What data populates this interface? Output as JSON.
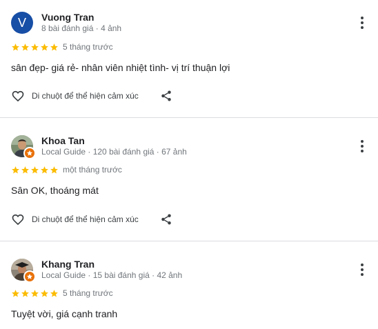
{
  "reviews": [
    {
      "avatar_letter": "V",
      "avatar_color": "#174ea6",
      "name": "Vuong Tran",
      "meta": "8 bài đánh giá · 4 ảnh",
      "rating": 5,
      "time": "5 tháng trước",
      "text": "sân đẹp- giá rẻ- nhân viên nhiệt tình- vị trí thuận lợi",
      "like_label": "Di chuột để thể hiện cảm xúc"
    },
    {
      "avatar_icon": "profile-photo-icon",
      "name": "Khoa Tan",
      "meta": "Local Guide · 120 bài đánh giá · 67 ảnh",
      "rating": 5,
      "time": "một tháng trước",
      "text": "Sân OK, thoáng mát",
      "like_label": "Di chuột để thể hiện cảm xúc"
    },
    {
      "avatar_icon": "profile-photo-icon",
      "name": "Khang Tran",
      "meta": "Local Guide · 15 bài đánh giá · 42 ảnh",
      "rating": 5,
      "time": "5 tháng trước",
      "text": "Tuyệt vời, giá cạnh tranh"
    }
  ],
  "colors": {
    "star": "#fbbc04",
    "local_guide_badge": "#e8710a",
    "divider": "#dadce0"
  }
}
